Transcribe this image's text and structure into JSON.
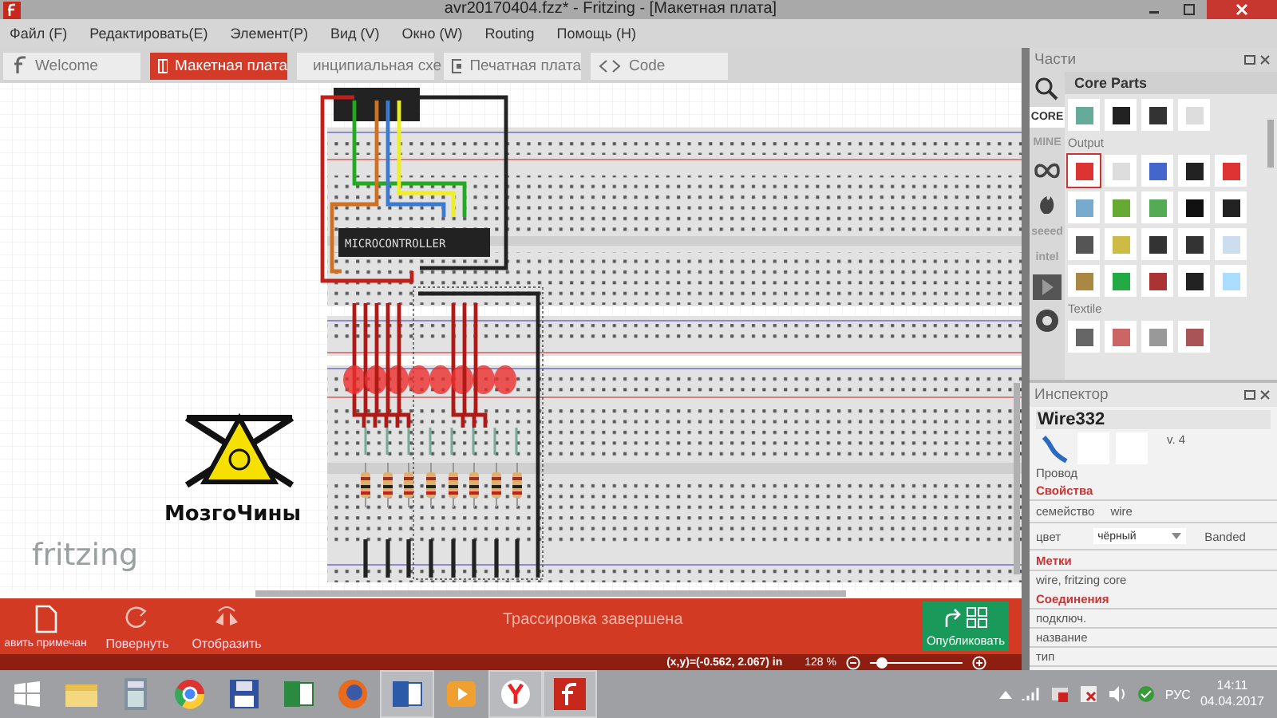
{
  "window": {
    "title": "avr20170404.fzz* - Fritzing - [Макетная плата]"
  },
  "menu": [
    "Файл (F)",
    "Редактировать(E)",
    "Элемент(P)",
    "Вид (V)",
    "Окно (W)",
    "Routing",
    "Помощь (H)"
  ],
  "tabs": [
    {
      "label": "Welcome",
      "kind": "welcome",
      "selected": false
    },
    {
      "label": "Макетная плата",
      "kind": "breadboard",
      "selected": true
    },
    {
      "label": "инципиальная схе",
      "kind": "schematic",
      "selected": false
    },
    {
      "label": "Печатная плата",
      "kind": "pcb",
      "selected": false
    },
    {
      "label": "Code",
      "kind": "code",
      "selected": false
    }
  ],
  "canvas": {
    "chip_label": "MICROCONTROLLER",
    "logo_text": "МозгоЧины",
    "brand": "fritzing"
  },
  "toolbar": {
    "buttons": [
      {
        "label": "авить примечан",
        "kind": "note"
      },
      {
        "label": "Повернуть",
        "kind": "rotate"
      },
      {
        "label": "Отобразить",
        "kind": "flip"
      }
    ],
    "message": "Трассировка завершена",
    "share": "Опубликовать"
  },
  "status_bar": {
    "coords": "(x,y)=(-0.562, 2.067) in",
    "zoom": "128 %",
    "zoom_slider": {
      "level": 0.12
    }
  },
  "parts": {
    "title": "Части",
    "bin_title": "Core Parts",
    "bins": [
      {
        "kind": "text",
        "label": "CORE",
        "selected": true
      },
      {
        "kind": "text",
        "label": "MINE",
        "selected": false
      },
      {
        "kind": "infinity",
        "selected": false
      },
      {
        "kind": "flame",
        "selected": false
      },
      {
        "kind": "text",
        "label": "seeed",
        "selected": false
      },
      {
        "kind": "text",
        "label": "intel",
        "selected": false
      },
      {
        "kind": "play",
        "selected": false
      },
      {
        "kind": "circle",
        "selected": false
      }
    ],
    "sections": [
      "Output",
      "Textile"
    ]
  },
  "inspector": {
    "title": "Инспектор",
    "name": "Wire332",
    "version": "v. 4",
    "type": "Провод",
    "properties_title": "Свойства",
    "properties": [
      {
        "kind": "text",
        "label": "семейство",
        "value": "wire"
      },
      {
        "kind": "dropdown",
        "label": "цвет",
        "value": "чёрный",
        "extra": "Banded"
      }
    ],
    "tags_title": "Метки",
    "tags": "wire, fritzing core",
    "connections_title": "Соединения",
    "connections": [
      "подключ.",
      "название",
      "тип"
    ]
  },
  "taskbar": {
    "apps": [
      {
        "kind": "start",
        "active": false
      },
      {
        "kind": "folder",
        "active": false
      },
      {
        "kind": "calculator",
        "active": false
      },
      {
        "kind": "chrome",
        "active": false
      },
      {
        "kind": "floppy",
        "active": false
      },
      {
        "kind": "excel",
        "active": false
      },
      {
        "kind": "firefox",
        "active": false
      },
      {
        "kind": "word",
        "active": true
      },
      {
        "kind": "media",
        "active": false
      },
      {
        "kind": "yandex",
        "active": true
      },
      {
        "kind": "fritzing",
        "active": true
      }
    ],
    "language": "РУС",
    "time": "14:11",
    "date": "04.04.2017"
  }
}
